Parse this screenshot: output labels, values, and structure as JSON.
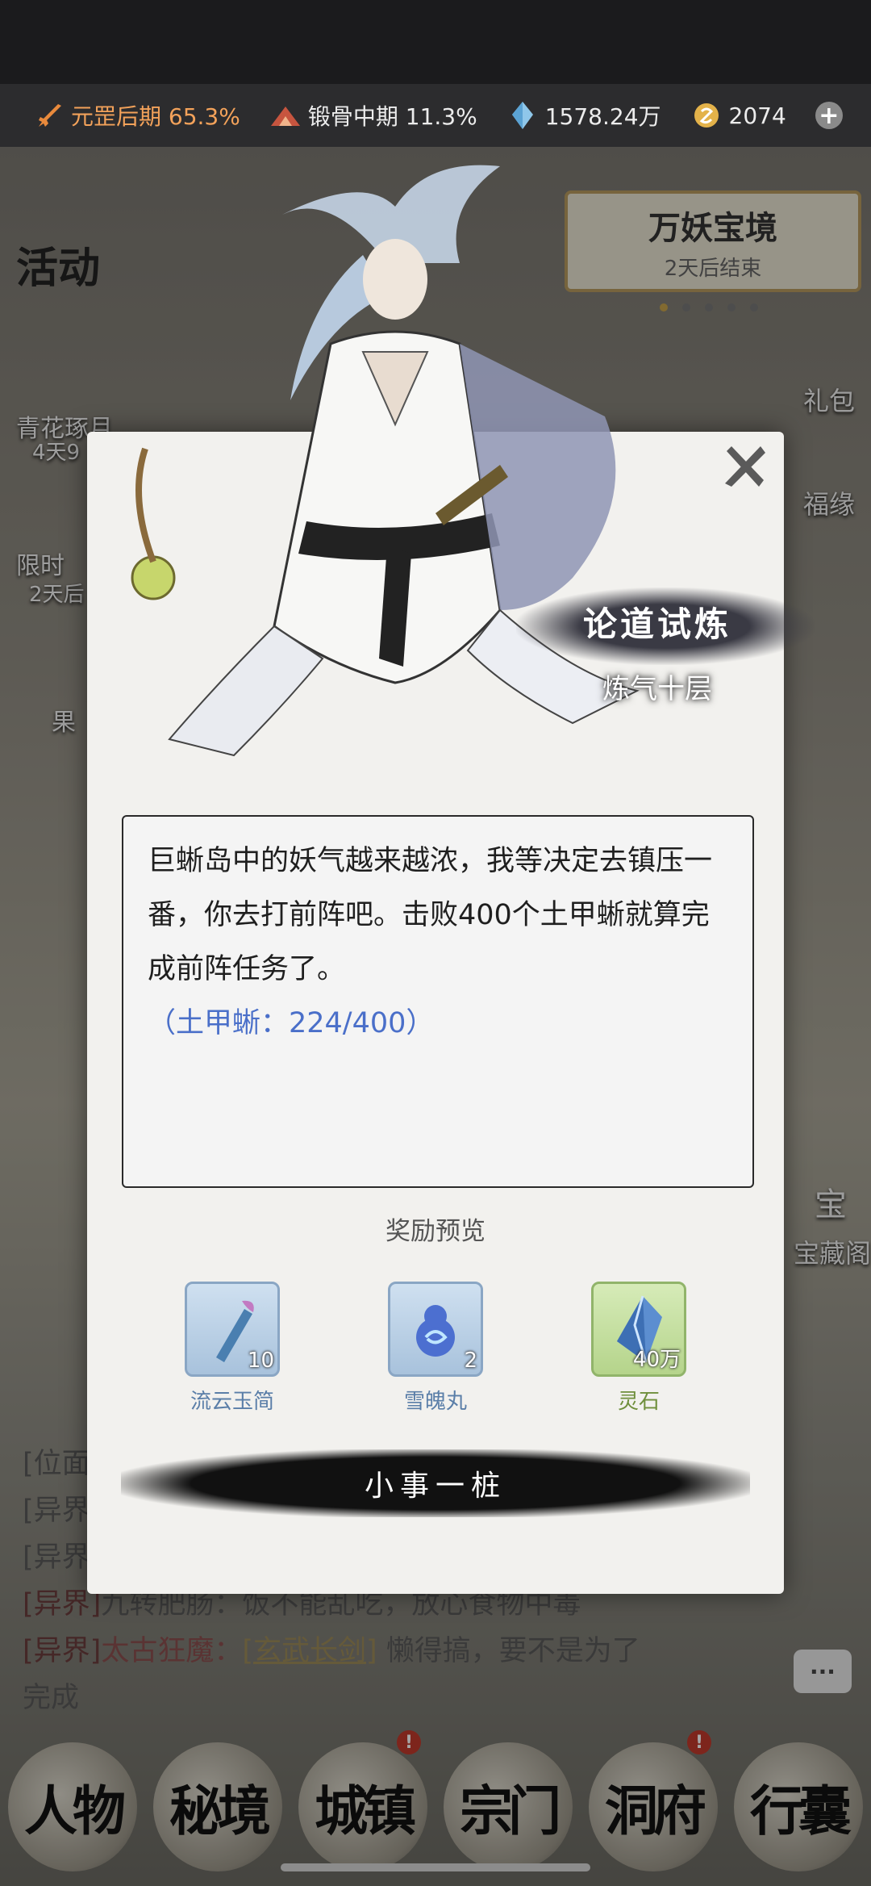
{
  "status": {
    "realm1": "元罡后期 65.3%",
    "realm2": "锻骨中期 11.3%",
    "spirit_stones": "1578.24万",
    "gold": "2074"
  },
  "left_side": {
    "activity": "活动",
    "item1_label": "青花琢月",
    "item1_sub": "4天9",
    "item2_label": "限时",
    "item2_sub": "2天后",
    "item3_label": "果"
  },
  "banner": {
    "title": "万妖宝境",
    "subtitle": "2天后结束"
  },
  "right_side": {
    "gift": "礼包",
    "fortune": "福缘",
    "treasure": "宝",
    "treasure_label": "宝藏阁"
  },
  "modal": {
    "title": "论道试炼",
    "subtitle": "炼气十层",
    "description": "巨蜥岛中的妖气越来越浓，我等决定去镇压一番，你去打前阵吧。击败400个土甲蜥就算完成前阵任务了。",
    "progress": "（土甲蜥：224/400）",
    "reward_title": "奖励预览",
    "rewards": [
      {
        "name": "流云玉简",
        "count": "10"
      },
      {
        "name": "雪魄丸",
        "count": "2"
      },
      {
        "name": "灵石",
        "count": "40万"
      }
    ],
    "confirm": "小事一桩"
  },
  "chat": {
    "line1": "[位面",
    "line2": "[异界",
    "line3": "[异界",
    "line4_channel": "[异界]",
    "line4_text": "九转肥肠：饭不能乱吃，放心食物中毒",
    "line5_channel": "[异界]",
    "line5_user": "太古狂魔：",
    "line5_item": "[玄武长剑]",
    "line5_text": "懒得搞，要不是为了",
    "line6": "完成",
    "more": "···"
  },
  "nav": [
    {
      "label": "人物"
    },
    {
      "label": "秘境"
    },
    {
      "label": "城镇",
      "badge": "!"
    },
    {
      "label": "宗门"
    },
    {
      "label": "洞府",
      "badge": "!"
    },
    {
      "label": "行囊"
    }
  ]
}
